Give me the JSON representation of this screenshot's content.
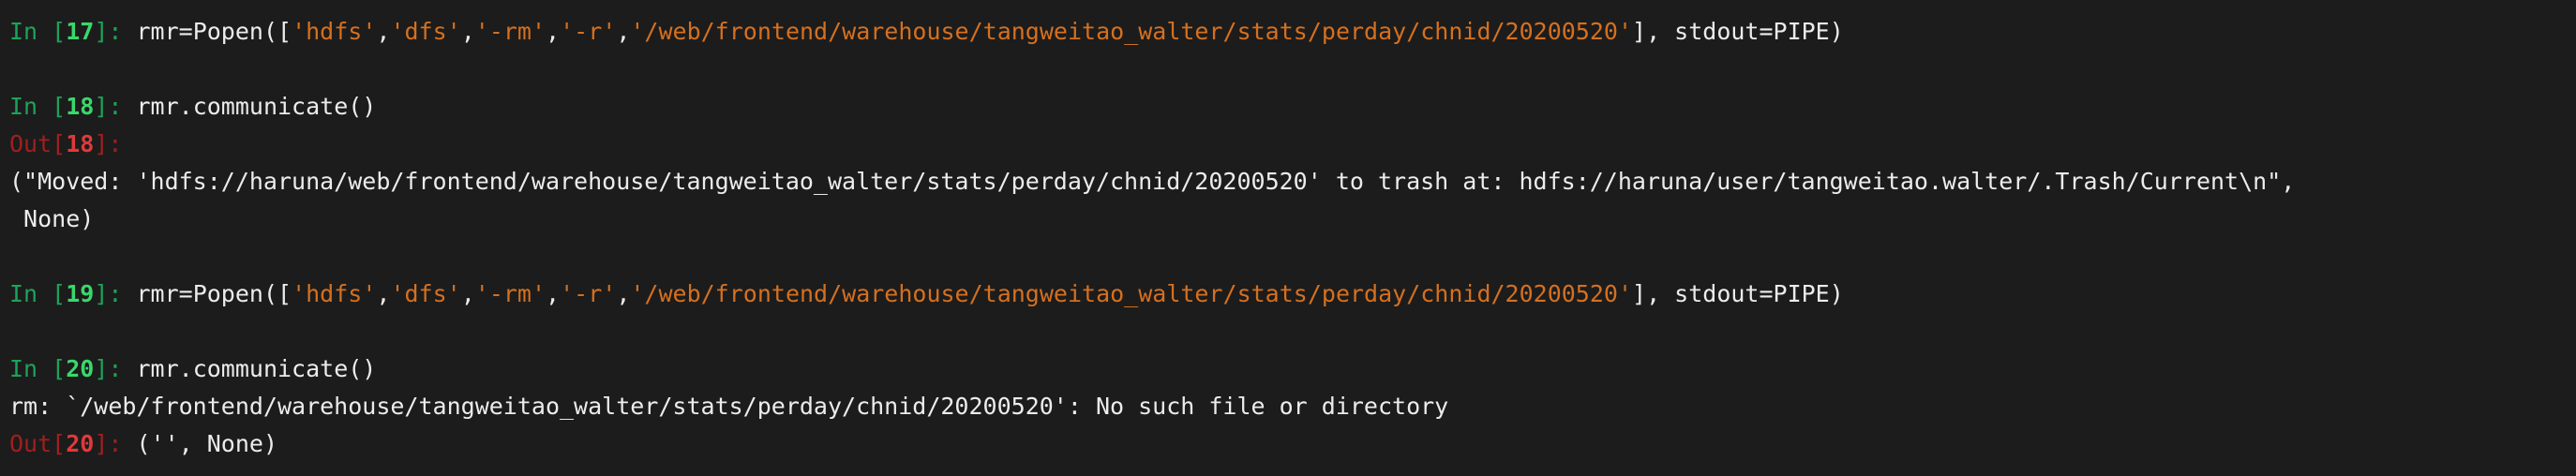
{
  "cells": [
    {
      "in_label": "In [",
      "in_num": "17",
      "in_suffix": "]: ",
      "code_prefix": "rmr=Popen([",
      "args": [
        "'hdfs'",
        "'dfs'",
        "'-rm'",
        "'-r'",
        "'/web/frontend/warehouse/tangweitao_walter/stats/perday/chnid/20200520'"
      ],
      "code_suffix": "], stdout=PIPE)"
    },
    {
      "in_label": "In [",
      "in_num": "18",
      "in_suffix": "]: ",
      "code": "rmr.communicate()",
      "out_label": "Out[",
      "out_num": "18",
      "out_suffix": "]:",
      "output_lines": [
        "(\"Moved: 'hdfs://haruna/web/frontend/warehouse/tangweitao_walter/stats/perday/chnid/20200520' to trash at: hdfs://haruna/user/tangweitao.walter/.Trash/Current\\n\",",
        " None)"
      ]
    },
    {
      "in_label": "In [",
      "in_num": "19",
      "in_suffix": "]: ",
      "code_prefix": "rmr=Popen([",
      "args": [
        "'hdfs'",
        "'dfs'",
        "'-rm'",
        "'-r'",
        "'/web/frontend/warehouse/tangweitao_walter/stats/perday/chnid/20200520'"
      ],
      "code_suffix": "], stdout=PIPE)"
    },
    {
      "in_label": "In [",
      "in_num": "20",
      "in_suffix": "]: ",
      "code": "rmr.communicate()",
      "stderr": "rm: `/web/frontend/warehouse/tangweitao_walter/stats/perday/chnid/20200520': No such file or directory",
      "out_label": "Out[",
      "out_num": "20",
      "out_suffix": "]: ",
      "output_inline": "('', None)"
    }
  ],
  "separator": ",",
  "colors": {
    "background": "#1c1c1c",
    "text": "#ececec",
    "in_prompt": "#1ca35a",
    "in_number": "#39d86b",
    "out_prompt": "#a11f1f",
    "out_number": "#e0393a",
    "string": "#d5701f"
  }
}
